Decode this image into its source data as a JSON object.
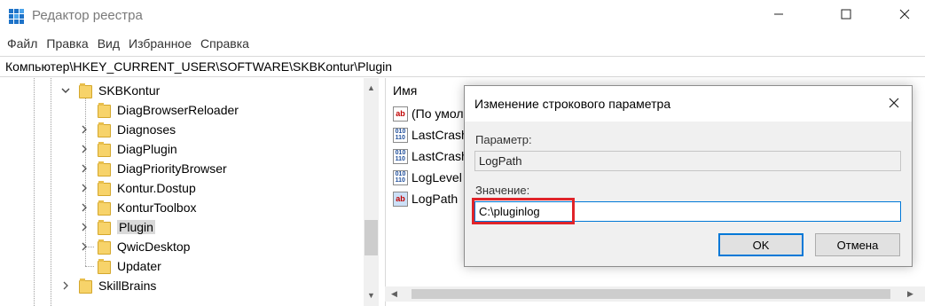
{
  "window": {
    "title": "Редактор реестра",
    "icons": {
      "app": "registry-editor-icon",
      "minimize": "minimize-icon",
      "maximize": "maximize-icon",
      "close": "close-icon"
    }
  },
  "menu": [
    "Файл",
    "Правка",
    "Вид",
    "Избранное",
    "Справка"
  ],
  "address": "Компьютер\\HKEY_CURRENT_USER\\SOFTWARE\\SKBKontur\\Plugin",
  "tree": {
    "parent": "SKBKontur",
    "children": [
      "DiagBrowserReloader",
      "Diagnoses",
      "DiagPlugin",
      "DiagPriorityBrowser",
      "Kontur.Dostup",
      "KonturToolbox",
      "Plugin",
      "QwicDesktop",
      "Updater"
    ],
    "sibling": "SkillBrains",
    "selected": "Plugin"
  },
  "list": {
    "header_name": "Имя",
    "rows": [
      {
        "name": "(По умол",
        "type": "string"
      },
      {
        "name": "LastCrash",
        "type": "binary"
      },
      {
        "name": "LastCrash",
        "type": "binary"
      },
      {
        "name": "LogLevel",
        "type": "binary"
      },
      {
        "name": "LogPath",
        "type": "string"
      }
    ]
  },
  "dialog": {
    "title": "Изменение строкового параметра",
    "param_label": "Параметр:",
    "param_value": "LogPath",
    "value_label": "Значение:",
    "value": "C:\\pluginlog",
    "ok": "OK",
    "cancel": "Отмена",
    "highlight_color": "#e0242a"
  }
}
